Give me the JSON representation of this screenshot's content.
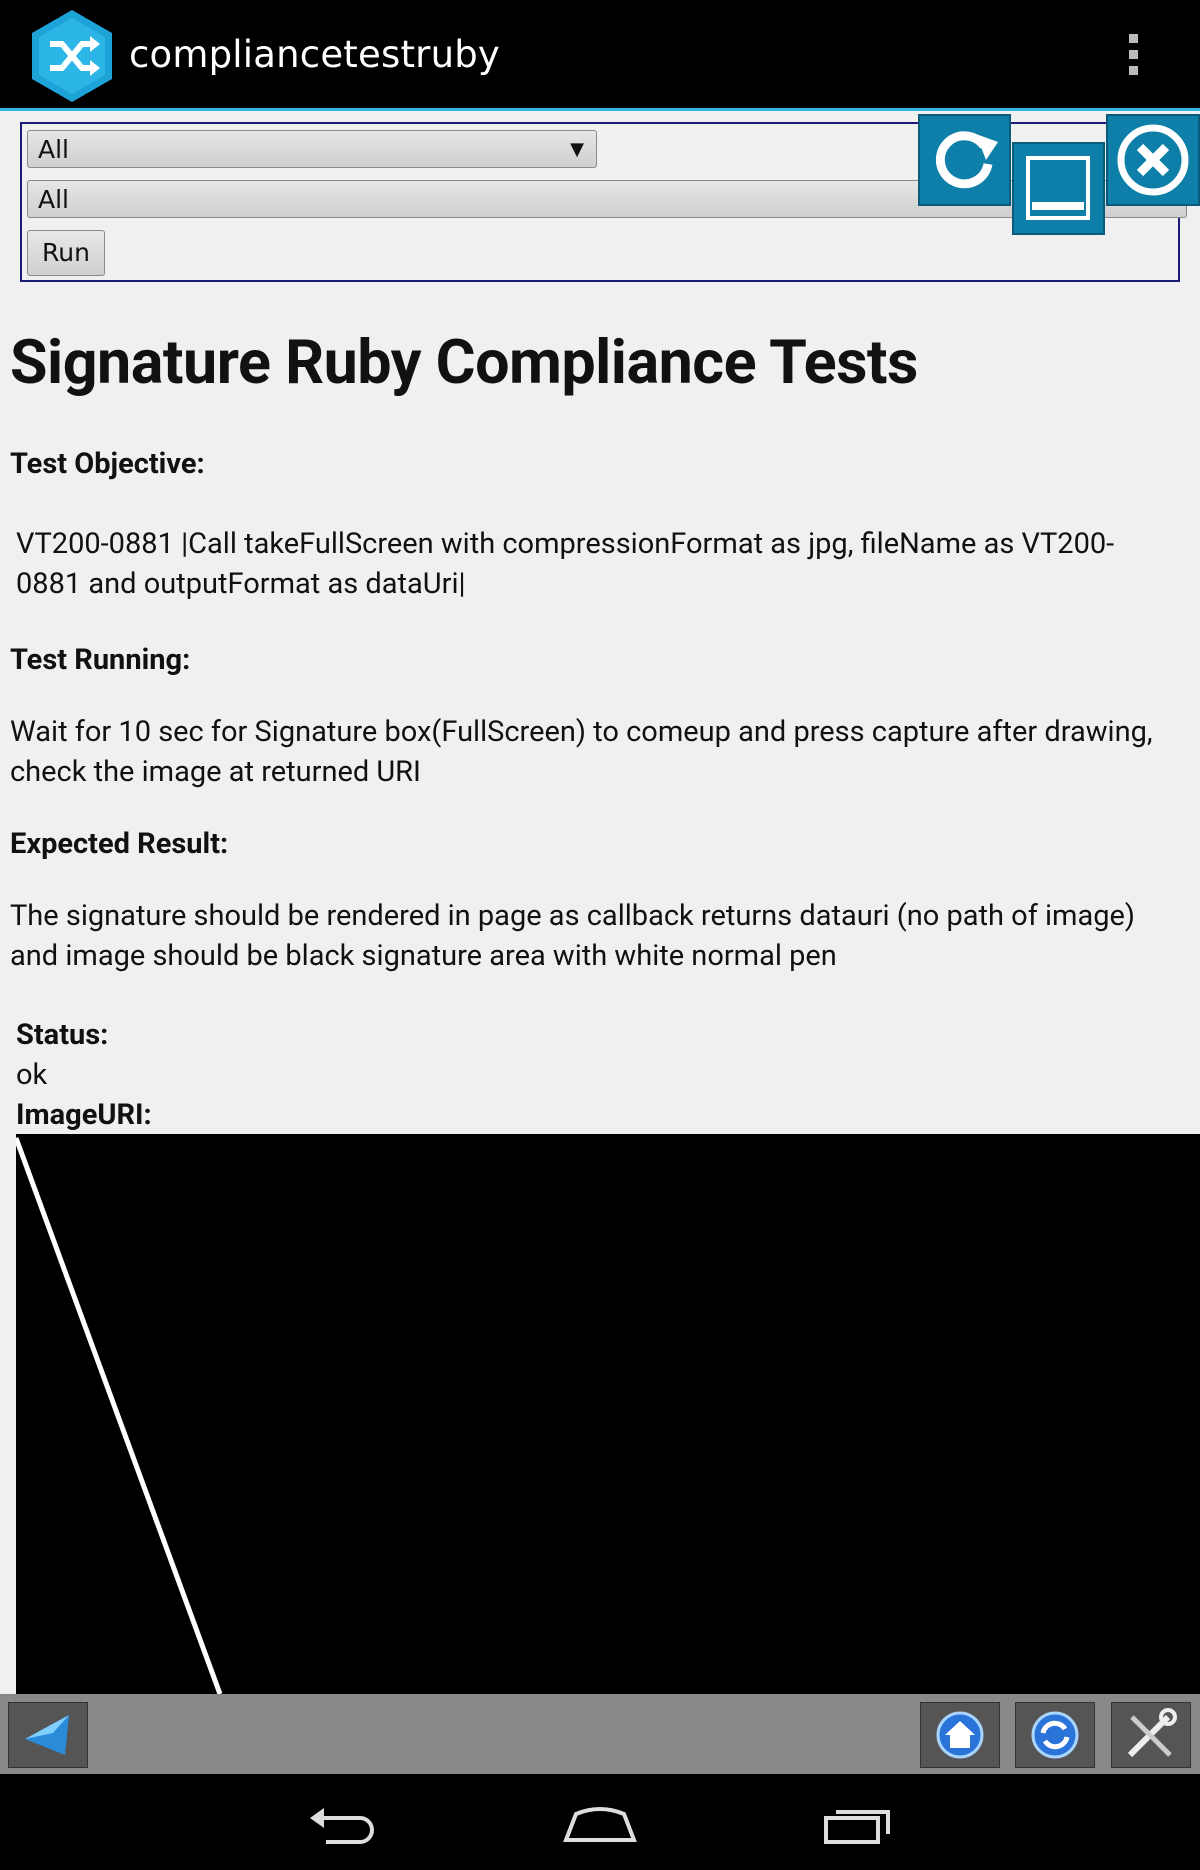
{
  "app": {
    "title": "compliancetestruby",
    "logo_icon": "shuffle-logo-icon",
    "accent_color": "#33b5e5"
  },
  "controls": {
    "select_suite": {
      "value": "All"
    },
    "select_filter": {
      "value": "All"
    },
    "run_label": "Run"
  },
  "floating_buttons": [
    "refresh-icon",
    "minimize-icon",
    "close-icon"
  ],
  "content": {
    "heading": "Signature Ruby Compliance Tests",
    "objective_label": "Test Objective:",
    "objective_text": "VT200-0881 |Call takeFullScreen with compressionFormat as jpg, fileName as VT200-0881 and outputFormat as dataUri|",
    "running_label": "Test Running:",
    "running_text": "Wait for 10 sec for Signature box(FullScreen) to comeup and press capture after drawing, check the image at returned URI",
    "expected_label": "Expected Result:",
    "expected_text": "The signature should be rendered in page as callback returns datauri (no path of image) and image should be black signature area with white normal pen",
    "status_label": "Status:",
    "status_value": "ok",
    "imageuri_label": "ImageURI:"
  },
  "toolbar": {
    "left": [
      "back-arrow-icon"
    ],
    "right": [
      "home-icon",
      "sync-icon",
      "settings-tools-icon"
    ]
  },
  "system_nav": [
    "back-icon",
    "home-icon",
    "recent-apps-icon"
  ]
}
